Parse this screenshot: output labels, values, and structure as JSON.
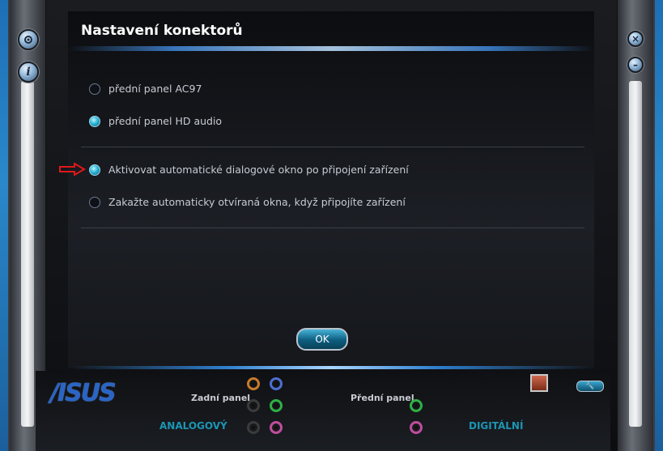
{
  "window": {
    "title": "Nastavení konektorů"
  },
  "sidebar_left": {
    "settings_icon": "gear-icon",
    "info_icon": "info-icon",
    "info_glyph": "i"
  },
  "sidebar_right": {
    "close_icon": "close-icon",
    "minimize_icon": "minimize-icon",
    "close_glyph": "×",
    "minimize_glyph": "–"
  },
  "panel_options": [
    {
      "label": "přední panel AC97",
      "selected": false
    },
    {
      "label": "přední panel HD audio",
      "selected": true
    }
  ],
  "dialog_options": [
    {
      "label": "Aktivovat automatické dialogové okno po připojení zařízení",
      "selected": true
    },
    {
      "label": "Zakažte automaticky otvíraná okna, když připojíte zařízení",
      "selected": false
    }
  ],
  "ok_button": {
    "label": "OK"
  },
  "footer": {
    "brand": "/ISUS",
    "rear_panel_label": "Zadní panel",
    "front_panel_label": "Přední panel",
    "analog_label": "ANALOGOVÝ",
    "digital_label": "DIGITÁLNÍ",
    "wrench_icon": "wrench-icon"
  },
  "colors": {
    "accent": "#1c95b4",
    "brand": "#2a64c5",
    "jack_orange": "#c87a2c",
    "jack_blue": "#4c6fd0",
    "jack_black": "#3b3b3b",
    "jack_green": "#2fb045",
    "jack_pink": "#c04d9c",
    "arrow_red": "#e01818"
  }
}
